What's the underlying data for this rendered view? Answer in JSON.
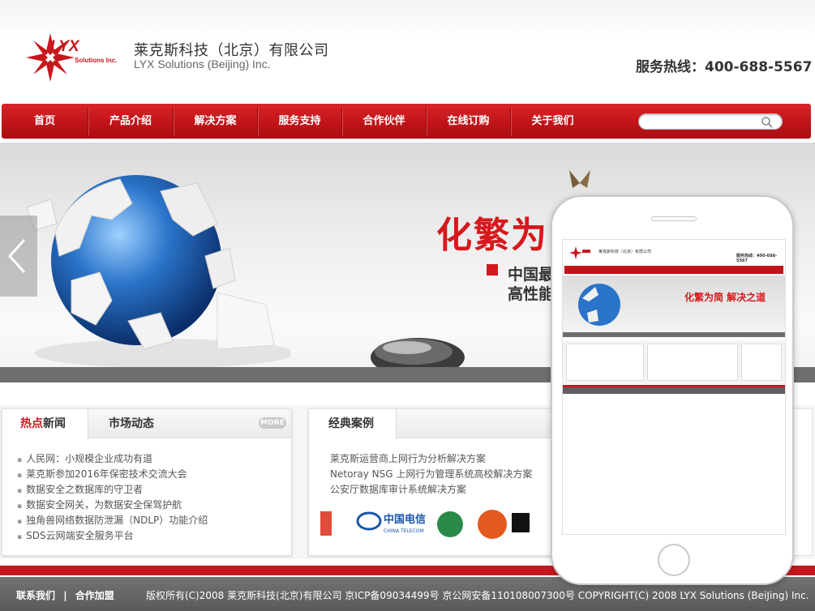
{
  "header": {
    "company_cn": "莱克斯科技（北京）有限公司",
    "company_en": "LYX Solutions (Beijing) Inc.",
    "logo_text": "LYX",
    "logo_sub": "Solutions Inc.",
    "hotline": "服务热线：400-688-5567"
  },
  "nav": {
    "items": [
      "首页",
      "产品介绍",
      "解决方案",
      "服务支持",
      "合作伙伴",
      "在线订购",
      "关于我们"
    ],
    "search_placeholder": ""
  },
  "banner": {
    "slogan": "化繁为",
    "sub1": "中国最",
    "sub2": "高性能"
  },
  "news_panel": {
    "tab_hot_red": "热点",
    "tab_hot_rest": "新闻",
    "tab_market": "市场动态",
    "more": "MORE",
    "items": [
      "人民网：小规模企业成功有道",
      "莱克斯参加2016年保密技术交流大会",
      "数据安全之数据库的守卫者",
      "数据安全网关，为数据安全保驾护航",
      "独角兽网络数据防泄漏（NDLP）功能介绍",
      "SDS云网端安全服务平台"
    ]
  },
  "case_panel": {
    "tab": "经典案例",
    "items": [
      "莱克斯运营商上网行为分析解决方案",
      "Netoray NSG 上网行为管理系统高校解决方案",
      "公安厅数据库审计系统解决方案"
    ],
    "partner_text": "中国电信",
    "partner_sub": "CHINA TELECOM"
  },
  "footer": {
    "contact": "联系我们",
    "sep": "|",
    "join": "合作加盟",
    "copyright": "版权所有(C)2008 莱克斯科技(北京)有限公司 京ICP备09034499号 京公网安备110108007300号 COPYRIGHT(C) 2008 LYX Solutions (BeiJing) Inc."
  },
  "phone_preview": {
    "title": "莱克斯科技（北京）有限公司",
    "hotline": "服务热线：400-688-5567",
    "slogan": "化繁为简 解决之道"
  },
  "colors": {
    "brand_red": "#c8161d",
    "nav_red": "#c01419",
    "footer_gray": "#5a5a5a"
  }
}
